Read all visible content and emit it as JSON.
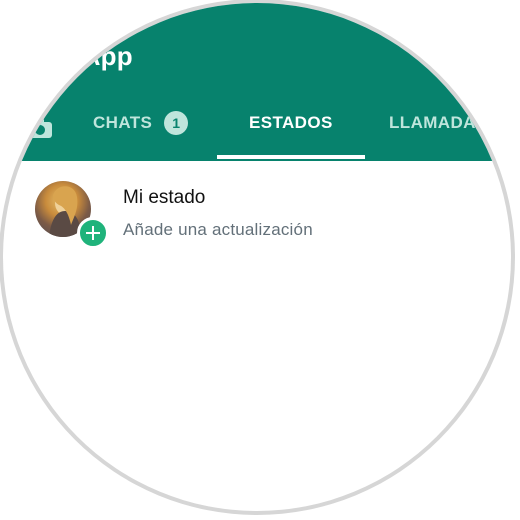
{
  "header": {
    "app_title": "sApp",
    "camera_icon": "camera-icon"
  },
  "tabs": [
    {
      "label": "CHATS",
      "badge": "1",
      "active": false
    },
    {
      "label": "ESTADOS",
      "active": true
    },
    {
      "label": "LLAMADA",
      "active": false
    }
  ],
  "my_status": {
    "title": "Mi estado",
    "subtitle": "Añade una actualización",
    "add_icon": "plus-icon"
  },
  "colors": {
    "brand": "#07826d",
    "accent": "#1fb37b",
    "inactive_tab": "#bfe5dc"
  }
}
